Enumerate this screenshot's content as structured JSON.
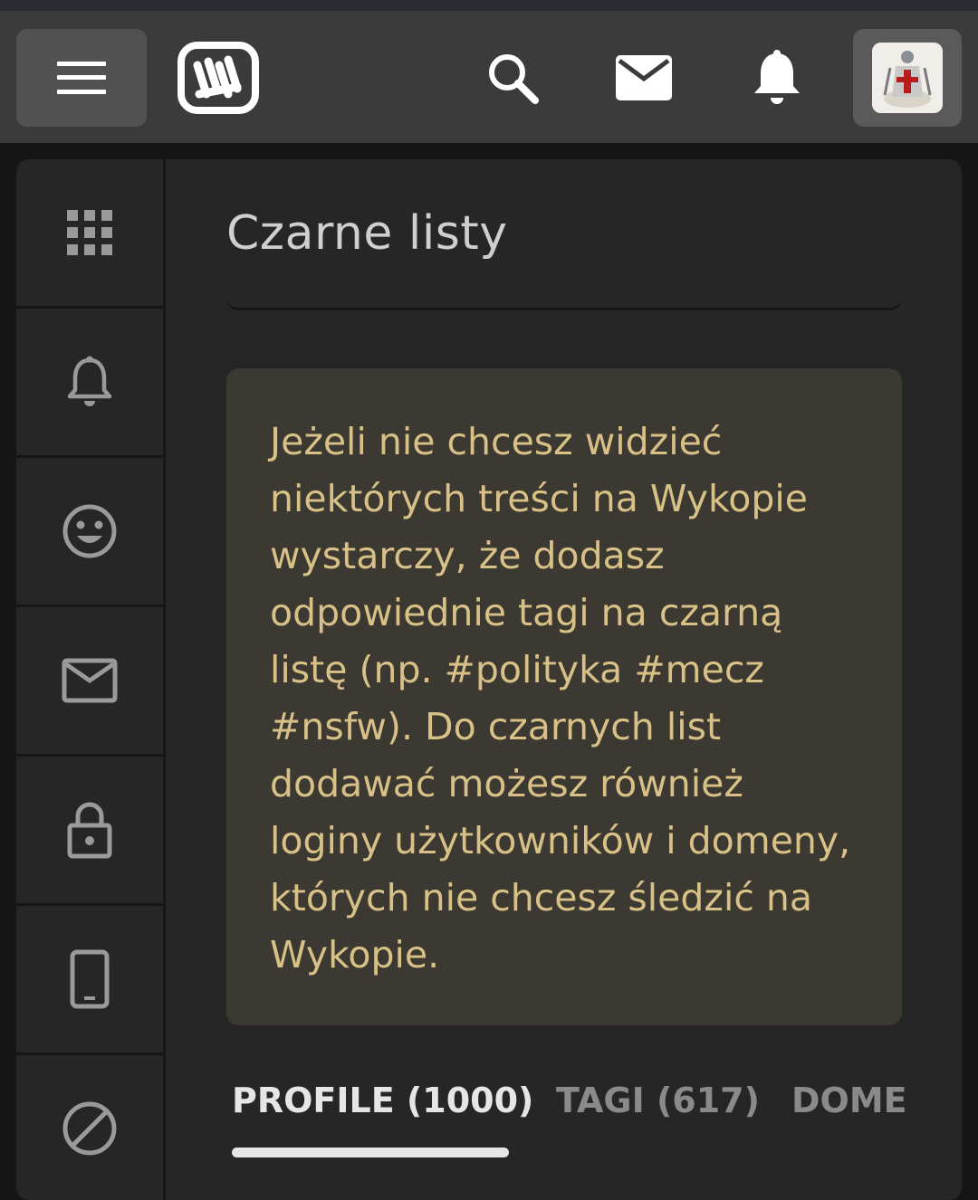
{
  "topbar": {
    "menu_icon": "hamburger-icon",
    "logo_icon": "wykop-logo-icon",
    "search_icon": "search-icon",
    "messages_icon": "mail-icon",
    "notifications_icon": "bell-icon",
    "avatar_icon": "user-avatar"
  },
  "sidenav": {
    "items": [
      {
        "icon": "grid-icon"
      },
      {
        "icon": "bell-icon"
      },
      {
        "icon": "smiley-icon"
      },
      {
        "icon": "mail-icon"
      },
      {
        "icon": "lock-icon"
      },
      {
        "icon": "phone-icon"
      },
      {
        "icon": "blocked-icon"
      }
    ]
  },
  "page": {
    "title": "Czarne listy",
    "info_text": "Jeżeli nie chcesz widzieć niektórych treści na Wykopie wystarczy, że dodasz odpowiednie tagi na czarną listę (np. #polityka #mecz #nsfw). Do czarnych list dodawać możesz również loginy użytkowników i domeny, których nie chcesz śledzić na Wykopie."
  },
  "tabs": [
    {
      "label": "PROFILE (1000)",
      "active": true
    },
    {
      "label": "TAGI (617)",
      "active": false
    },
    {
      "label": "DOME",
      "active": false
    }
  ],
  "colors": {
    "topbar_bg": "#3b3b3b",
    "panel_bg": "#262626",
    "info_bg": "#3c3832",
    "info_text": "#d8c187",
    "tab_active": "#e6e6e6",
    "tab_inactive": "#8a8a8a"
  }
}
